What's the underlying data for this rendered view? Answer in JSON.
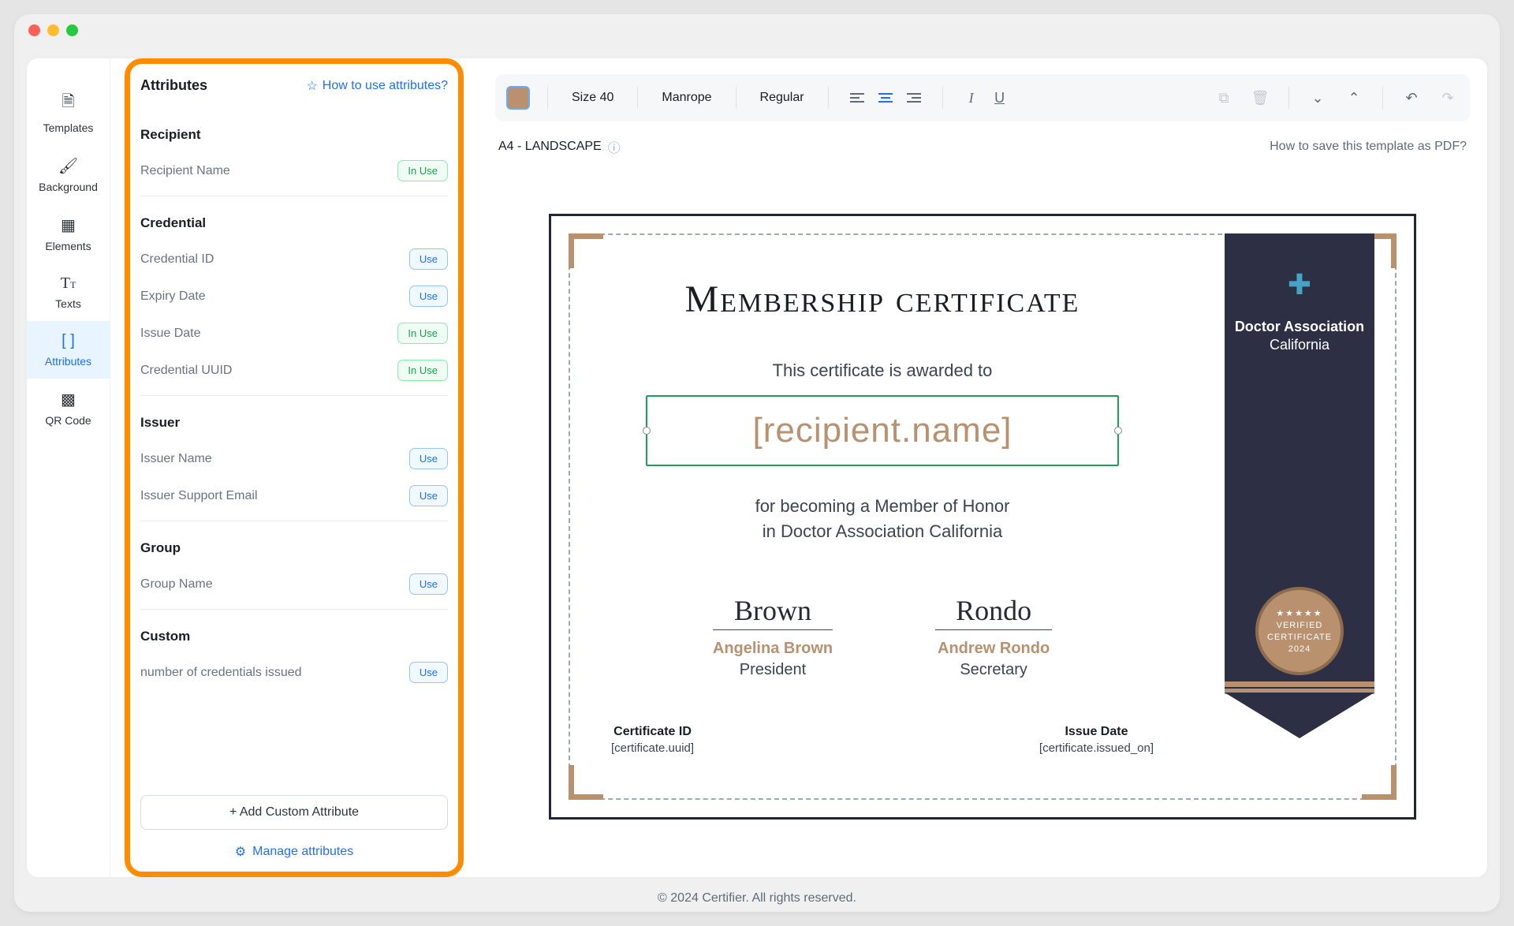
{
  "sidebar": {
    "items": [
      {
        "label": "Templates"
      },
      {
        "label": "Background"
      },
      {
        "label": "Elements"
      },
      {
        "label": "Texts"
      },
      {
        "label": "Attributes"
      },
      {
        "label": "QR Code"
      }
    ]
  },
  "attr_panel": {
    "title": "Attributes",
    "how_link": "How to use attributes?",
    "sections": {
      "recipient": {
        "title": "Recipient",
        "items": [
          {
            "name": "Recipient Name",
            "badge": "In Use"
          }
        ]
      },
      "credential": {
        "title": "Credential",
        "items": [
          {
            "name": "Credential ID",
            "badge": "Use"
          },
          {
            "name": "Expiry Date",
            "badge": "Use"
          },
          {
            "name": "Issue Date",
            "badge": "In Use"
          },
          {
            "name": "Credential UUID",
            "badge": "In Use"
          }
        ]
      },
      "issuer": {
        "title": "Issuer",
        "items": [
          {
            "name": "Issuer Name",
            "badge": "Use"
          },
          {
            "name": "Issuer Support Email",
            "badge": "Use"
          }
        ]
      },
      "group": {
        "title": "Group",
        "items": [
          {
            "name": "Group Name",
            "badge": "Use"
          }
        ]
      },
      "custom": {
        "title": "Custom",
        "items": [
          {
            "name": "number of credentials issued",
            "badge": "Use"
          }
        ]
      }
    },
    "add_button": "+ Add Custom Attribute",
    "manage_link": "Manage attributes"
  },
  "toolbar": {
    "size": "Size 40",
    "font": "Manrope",
    "weight": "Regular"
  },
  "subheader": {
    "format": "A4 - LANDSCAPE",
    "help": "How to save this template as PDF?"
  },
  "certificate": {
    "title": "Membership certificate",
    "subtitle": "This certificate is awarded to",
    "placeholder": "[recipient.name]",
    "desc1": "for becoming a Member of Honor",
    "desc2": "in Doctor Association California",
    "sig1": {
      "script": "Brown",
      "name": "Angelina Brown",
      "role": "President"
    },
    "sig2": {
      "script": "Rondo",
      "name": "Andrew Rondo",
      "role": "Secretary"
    },
    "footer": {
      "id_label": "Certificate ID",
      "id_val": "[certificate.uuid]",
      "date_label": "Issue Date",
      "date_val": "[certificate.issued_on]"
    },
    "ribbon": {
      "org": "Doctor Association",
      "loc": "California",
      "seal_l1": "★★★★★",
      "seal_l2": "VERIFIED",
      "seal_l3": "CERTIFICATE",
      "seal_l4": "2024"
    }
  },
  "footer": "© 2024 Certifier. All rights reserved."
}
